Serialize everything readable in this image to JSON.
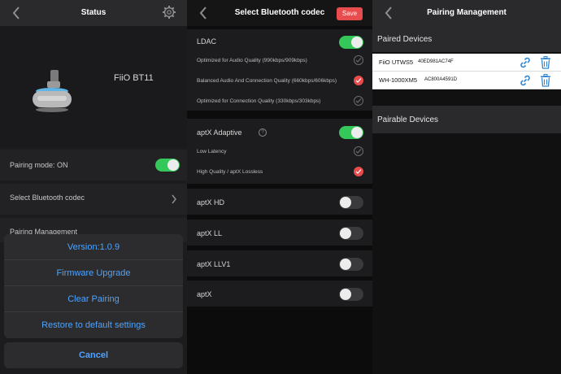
{
  "status": {
    "title": "Status",
    "device_name": "FiiO BT11",
    "pairing_mode_label": "Pairing mode: ON",
    "select_codec_label": "Select Bluetooth codec",
    "pairing_management_label": "Pairing Management",
    "sheet": {
      "version": "Version:1.0.9",
      "firmware": "Firmware Upgrade",
      "clear": "Clear Pairing",
      "restore": "Restore to default settings",
      "cancel": "Cancel"
    }
  },
  "codec": {
    "title": "Select Bluetooth codec",
    "save": "Save",
    "ldac": {
      "label": "LDAC",
      "options": [
        "Optimized for Audio Quality (990kbps/909kbps)",
        "Balanced Audio And Connection Quality (660kbps/606kbps)",
        "Optimized for Connection Quality (330kbps/303kbps)"
      ]
    },
    "aptx_adaptive": {
      "label": "aptX Adaptive",
      "info": "?",
      "options": [
        "Low Latency",
        "High Quality / aptX Lossless"
      ]
    },
    "aptx_hd": "aptX HD",
    "aptx_ll": "aptX LL",
    "aptx_llv1": "aptX LLV1",
    "aptx": "aptX"
  },
  "pairing": {
    "title": "Pairing Management",
    "paired_title": "Paired Devices",
    "devices": [
      {
        "name": "FiiO UTWS5",
        "mac": "40ED981AC74F"
      },
      {
        "name": "WH-1000XM5",
        "mac": "AC800A4591D"
      }
    ],
    "pairable_title": "Pairable Devices"
  },
  "colors": {
    "accent_blue": "#4da3ff",
    "toggle_on": "#34c759",
    "save_red": "#e84c4c"
  }
}
